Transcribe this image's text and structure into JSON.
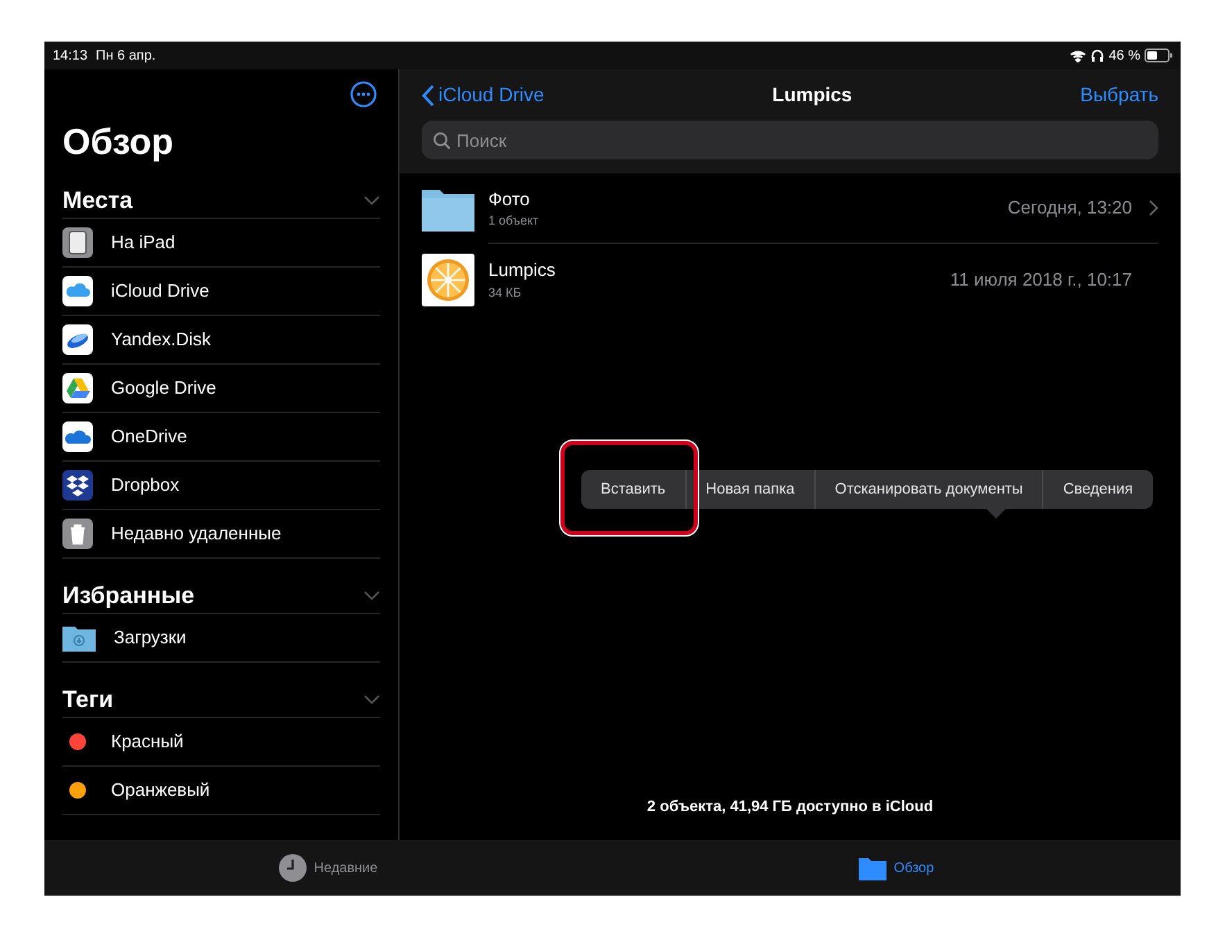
{
  "status_bar": {
    "time": "14:13",
    "date": "Пн 6 апр.",
    "battery": "46 %"
  },
  "sidebar": {
    "title": "Обзор",
    "sections": [
      {
        "title": "Места",
        "items": [
          {
            "kind": "ipad",
            "label": "На iPad"
          },
          {
            "kind": "icloud",
            "label": "iCloud Drive"
          },
          {
            "kind": "yandex",
            "label": "Yandex.Disk"
          },
          {
            "kind": "gdrive",
            "label": "Google Drive"
          },
          {
            "kind": "onedrive",
            "label": "OneDrive"
          },
          {
            "kind": "dropbox",
            "label": "Dropbox"
          },
          {
            "kind": "trash",
            "label": "Недавно удаленные"
          }
        ]
      },
      {
        "title": "Избранные",
        "items": [
          {
            "kind": "downloads",
            "label": "Загрузки"
          }
        ]
      },
      {
        "title": "Теги",
        "items": [
          {
            "kind": "tag",
            "label": "Красный",
            "color": "#ff453a"
          },
          {
            "kind": "tag",
            "label": "Оранжевый",
            "color": "#ff9f0a"
          }
        ]
      }
    ]
  },
  "nav": {
    "back": "iCloud Drive",
    "title": "Lumpics",
    "action": "Выбрать"
  },
  "search": {
    "placeholder": "Поиск"
  },
  "files": [
    {
      "kind": "folder",
      "name": "Фото",
      "info": "1 объект",
      "date": "Сегодня, 13:20"
    },
    {
      "kind": "image",
      "name": "Lumpics",
      "info": "34 КБ",
      "date": "11 июля 2018 г., 10:17"
    }
  ],
  "context_menu": [
    {
      "label": "Вставить",
      "highlighted": true
    },
    {
      "label": "Новая папка",
      "highlighted": false
    },
    {
      "label": "Отсканировать документы",
      "highlighted": false
    },
    {
      "label": "Сведения",
      "highlighted": false
    }
  ],
  "footer": "2 объекта, 41,94 ГБ доступно в iCloud",
  "tab_bar": [
    {
      "label": "Недавние",
      "selected": false,
      "kind": "recents"
    },
    {
      "label": "Обзор",
      "selected": true,
      "kind": "browse"
    }
  ]
}
